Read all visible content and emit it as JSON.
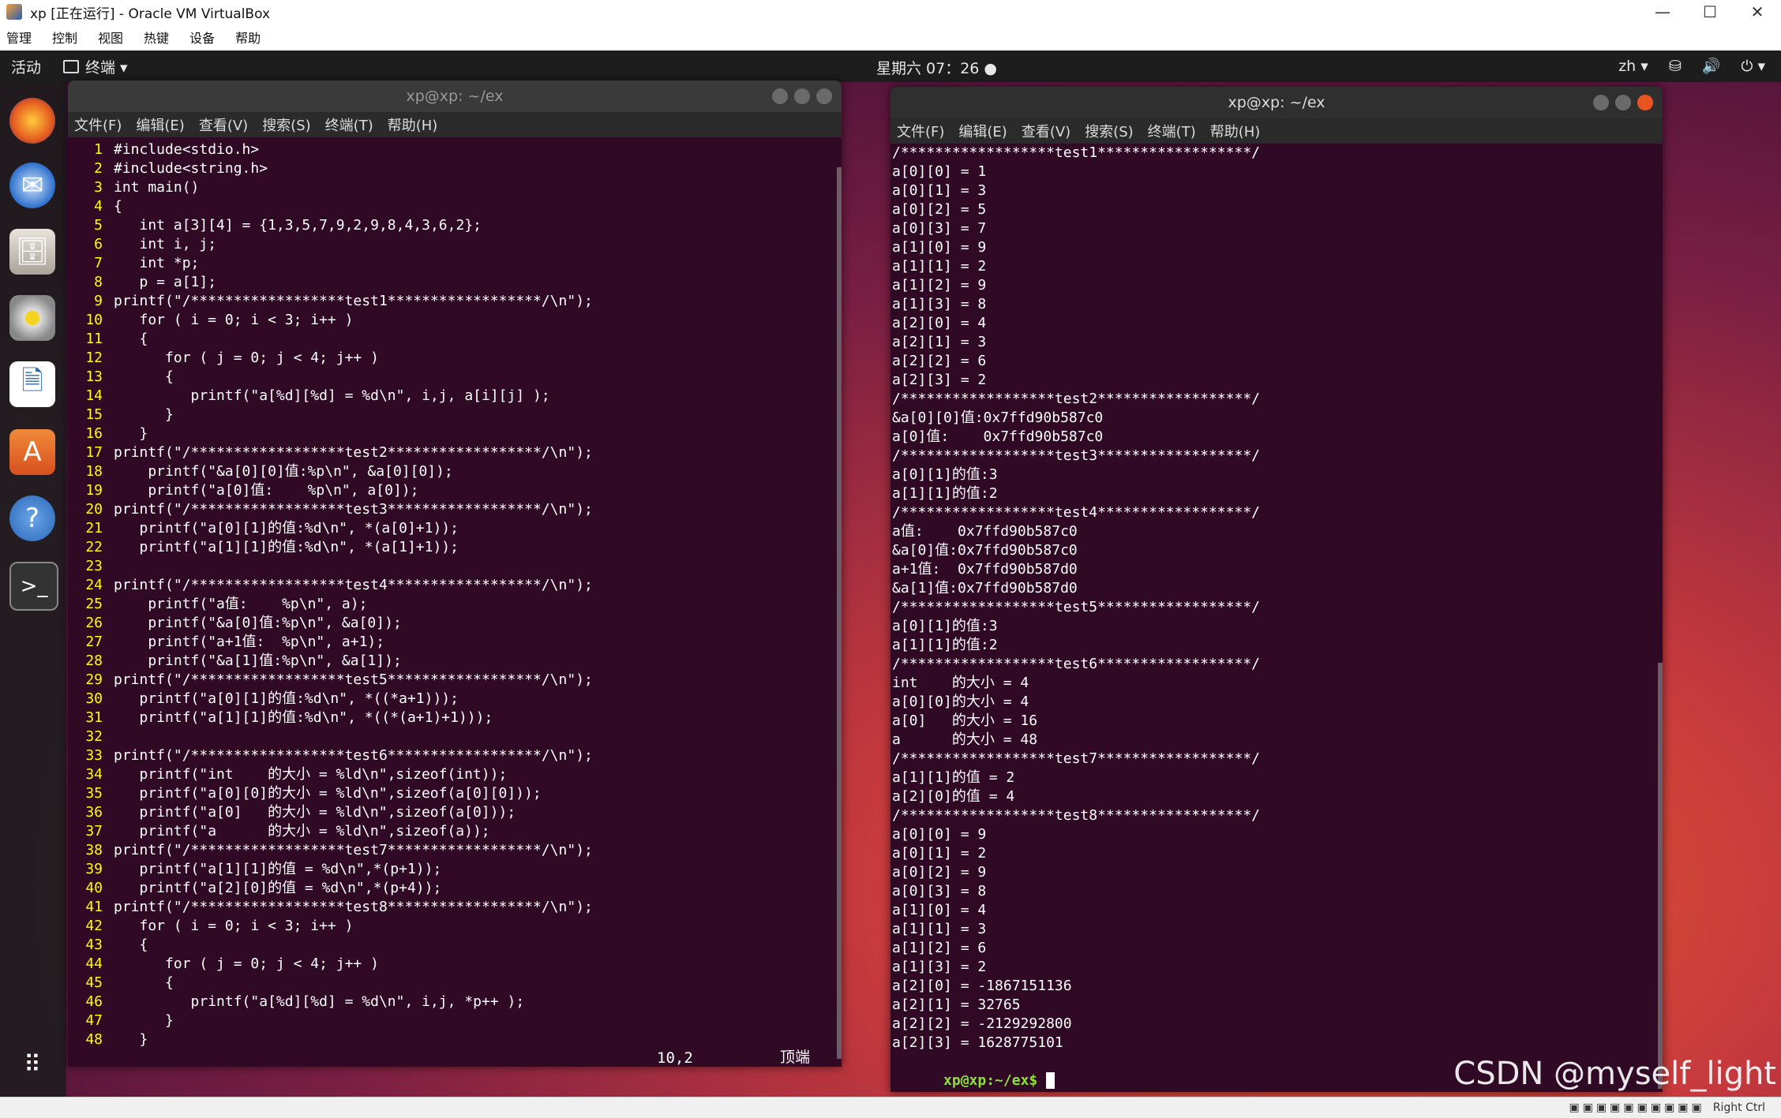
{
  "host": {
    "title": "xp [正在运行] - Oracle VM VirtualBox",
    "menu": [
      "管理",
      "控制",
      "视图",
      "热键",
      "设备",
      "帮助"
    ],
    "status_right": "Right Ctrl"
  },
  "topbar": {
    "activities": "活动",
    "terminal_menu": "终端 ▾",
    "clock": "星期六 07：26 ●",
    "lang": "zh ▾"
  },
  "editor": {
    "title": "xp@xp: ~/ex",
    "menu": [
      "文件(F)",
      "编辑(E)",
      "查看(V)",
      "搜索(S)",
      "终端(T)",
      "帮助(H)"
    ],
    "lines": [
      "#include<stdio.h>",
      "#include<string.h>",
      "int main()",
      "{",
      "   int a[3][4] = {1,3,5,7,9,2,9,8,4,3,6,2};",
      "   int i, j;",
      "   int *p;",
      "   p = a[1];",
      "printf(\"/******************test1******************/\\n\");",
      "   for ( i = 0; i < 3; i++ )",
      "   {",
      "      for ( j = 0; j < 4; j++ )",
      "      {",
      "         printf(\"a[%d][%d] = %d\\n\", i,j, a[i][j] );",
      "      }",
      "   }",
      "printf(\"/******************test2******************/\\n\");",
      "    printf(\"&a[0][0]值:%p\\n\", &a[0][0]);",
      "    printf(\"a[0]值:    %p\\n\", a[0]);",
      "printf(\"/******************test3******************/\\n\");",
      "   printf(\"a[0][1]的值:%d\\n\", *(a[0]+1));",
      "   printf(\"a[1][1]的值:%d\\n\", *(a[1]+1));",
      "",
      "printf(\"/******************test4******************/\\n\");",
      "    printf(\"a值:    %p\\n\", a);",
      "    printf(\"&a[0]值:%p\\n\", &a[0]);",
      "    printf(\"a+1值:  %p\\n\", a+1);",
      "    printf(\"&a[1]值:%p\\n\", &a[1]);",
      "printf(\"/******************test5******************/\\n\");",
      "   printf(\"a[0][1]的值:%d\\n\", *((*a+1)));",
      "   printf(\"a[1][1]的值:%d\\n\", *((*(a+1)+1)));",
      "",
      "printf(\"/******************test6******************/\\n\");",
      "   printf(\"int    的大小 = %ld\\n\",sizeof(int));",
      "   printf(\"a[0][0]的大小 = %ld\\n\",sizeof(a[0][0]));",
      "   printf(\"a[0]   的大小 = %ld\\n\",sizeof(a[0]));",
      "   printf(\"a      的大小 = %ld\\n\",sizeof(a));",
      "printf(\"/******************test7******************/\\n\");",
      "   printf(\"a[1][1]的值 = %d\\n\",*(p+1));",
      "   printf(\"a[2][0]的值 = %d\\n\",*(p+4));",
      "printf(\"/******************test8******************/\\n\");",
      "   for ( i = 0; i < 3; i++ )",
      "   {",
      "      for ( j = 0; j < 4; j++ )",
      "      {",
      "         printf(\"a[%d][%d] = %d\\n\", i,j, *p++ );",
      "      }",
      "   }"
    ],
    "cursor_pos": "10,2",
    "scroll_pos": "顶端"
  },
  "output": {
    "title": "xp@xp: ~/ex",
    "menu": [
      "文件(F)",
      "编辑(E)",
      "查看(V)",
      "搜索(S)",
      "终端(T)",
      "帮助(H)"
    ],
    "lines": [
      "/******************test1******************/",
      "a[0][0] = 1",
      "a[0][1] = 3",
      "a[0][2] = 5",
      "a[0][3] = 7",
      "a[1][0] = 9",
      "a[1][1] = 2",
      "a[1][2] = 9",
      "a[1][3] = 8",
      "a[2][0] = 4",
      "a[2][1] = 3",
      "a[2][2] = 6",
      "a[2][3] = 2",
      "/******************test2******************/",
      "&a[0][0]值:0x7ffd90b587c0",
      "a[0]值:    0x7ffd90b587c0",
      "/******************test3******************/",
      "a[0][1]的值:3",
      "a[1][1]的值:2",
      "/******************test4******************/",
      "a值:    0x7ffd90b587c0",
      "&a[0]值:0x7ffd90b587c0",
      "a+1值:  0x7ffd90b587d0",
      "&a[1]值:0x7ffd90b587d0",
      "/******************test5******************/",
      "a[0][1]的值:3",
      "a[1][1]的值:2",
      "/******************test6******************/",
      "int    的大小 = 4",
      "a[0][0]的大小 = 4",
      "a[0]   的大小 = 16",
      "a      的大小 = 48",
      "/******************test7******************/",
      "a[1][1]的值 = 2",
      "a[2][0]的值 = 4",
      "/******************test8******************/",
      "a[0][0] = 9",
      "a[0][1] = 2",
      "a[0][2] = 9",
      "a[0][3] = 8",
      "a[1][0] = 4",
      "a[1][1] = 3",
      "a[1][2] = 6",
      "a[1][3] = 2",
      "a[2][0] = -1867151136",
      "a[2][1] = 32765",
      "a[2][2] = -2129292800",
      "a[2][3] = 1628775101"
    ],
    "prompt": "xp@xp:~/ex$"
  },
  "watermark": "CSDN @myself_light"
}
